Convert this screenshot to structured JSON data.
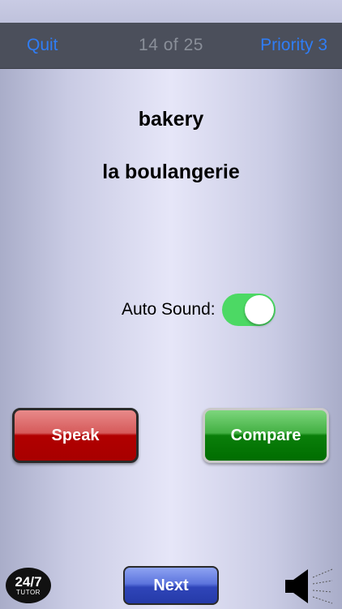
{
  "nav": {
    "quit_label": "Quit",
    "counter": "14  of  25",
    "priority_label": "Priority 3"
  },
  "card": {
    "english": "bakery",
    "french": "la boulangerie"
  },
  "auto_sound": {
    "label": "Auto Sound:",
    "enabled": true
  },
  "buttons": {
    "speak_label": "Speak",
    "compare_label": "Compare",
    "next_label": "Next"
  },
  "logo": {
    "big": "24/7",
    "small": "TUTOR"
  },
  "colors": {
    "toggle_on": "#4cd964",
    "nav_link": "#2f7df6",
    "speak": "#b10000",
    "compare": "#0a7f0a",
    "next": "#2f45b9"
  },
  "icons": {
    "speaker": "speaker-icon"
  }
}
